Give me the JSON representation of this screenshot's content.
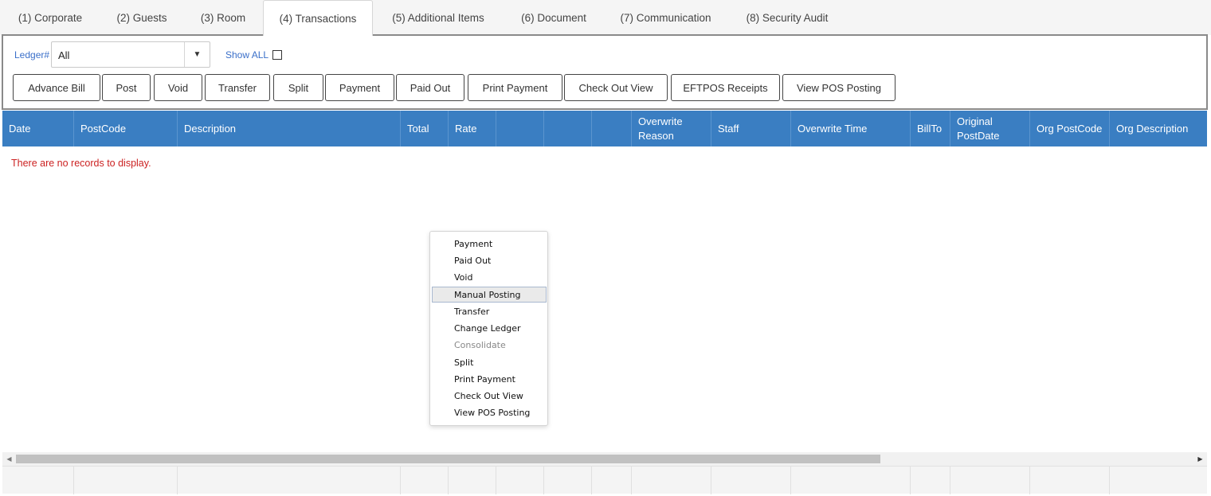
{
  "tabs": [
    {
      "label": "(1) Corporate"
    },
    {
      "label": "(2) Guests"
    },
    {
      "label": "(3) Room"
    },
    {
      "label": "(4) Transactions",
      "active": true
    },
    {
      "label": "(5) Additional Items"
    },
    {
      "label": "(6) Document"
    },
    {
      "label": "(7) Communication"
    },
    {
      "label": "(8) Security Audit"
    }
  ],
  "toolbar": {
    "ledger_label": "Ledger#",
    "ledger_value": "All",
    "ledger_arrow": "▼",
    "show_all_label": "Show ALL",
    "show_all_checked": false,
    "buttons": [
      "Advance Bill",
      "Post",
      "Void",
      "Transfer",
      "Split",
      "Payment",
      "Paid Out",
      "Print Payment",
      "Check Out View",
      "EFTPOS Receipts",
      "View POS Posting"
    ]
  },
  "grid": {
    "columns": [
      "Date",
      "PostCode",
      "Description",
      "Total",
      "Rate",
      "",
      "",
      "",
      "Overwrite Reason",
      "Staff",
      "Overwrite Time",
      "BillTo",
      "Original PostDate",
      "Org PostCode",
      "Org Description"
    ],
    "empty_message": "There are no records to display."
  },
  "context_menu": {
    "items": [
      {
        "label": "Payment"
      },
      {
        "label": "Paid Out"
      },
      {
        "label": "Void"
      },
      {
        "label": "Manual Posting",
        "highlighted": true
      },
      {
        "label": "Transfer"
      },
      {
        "label": "Change Ledger"
      },
      {
        "label": "Consolidate",
        "disabled": true
      },
      {
        "label": "Split"
      },
      {
        "label": "Print Payment"
      },
      {
        "label": "Check Out View"
      },
      {
        "label": "View POS Posting"
      }
    ]
  },
  "scrollbar": {
    "left_arrow": "◀",
    "right_arrow": "▶"
  },
  "colors": {
    "header_bg": "#3a7ec2",
    "link_blue": "#3a6fc9",
    "error_red": "#cc2222"
  }
}
